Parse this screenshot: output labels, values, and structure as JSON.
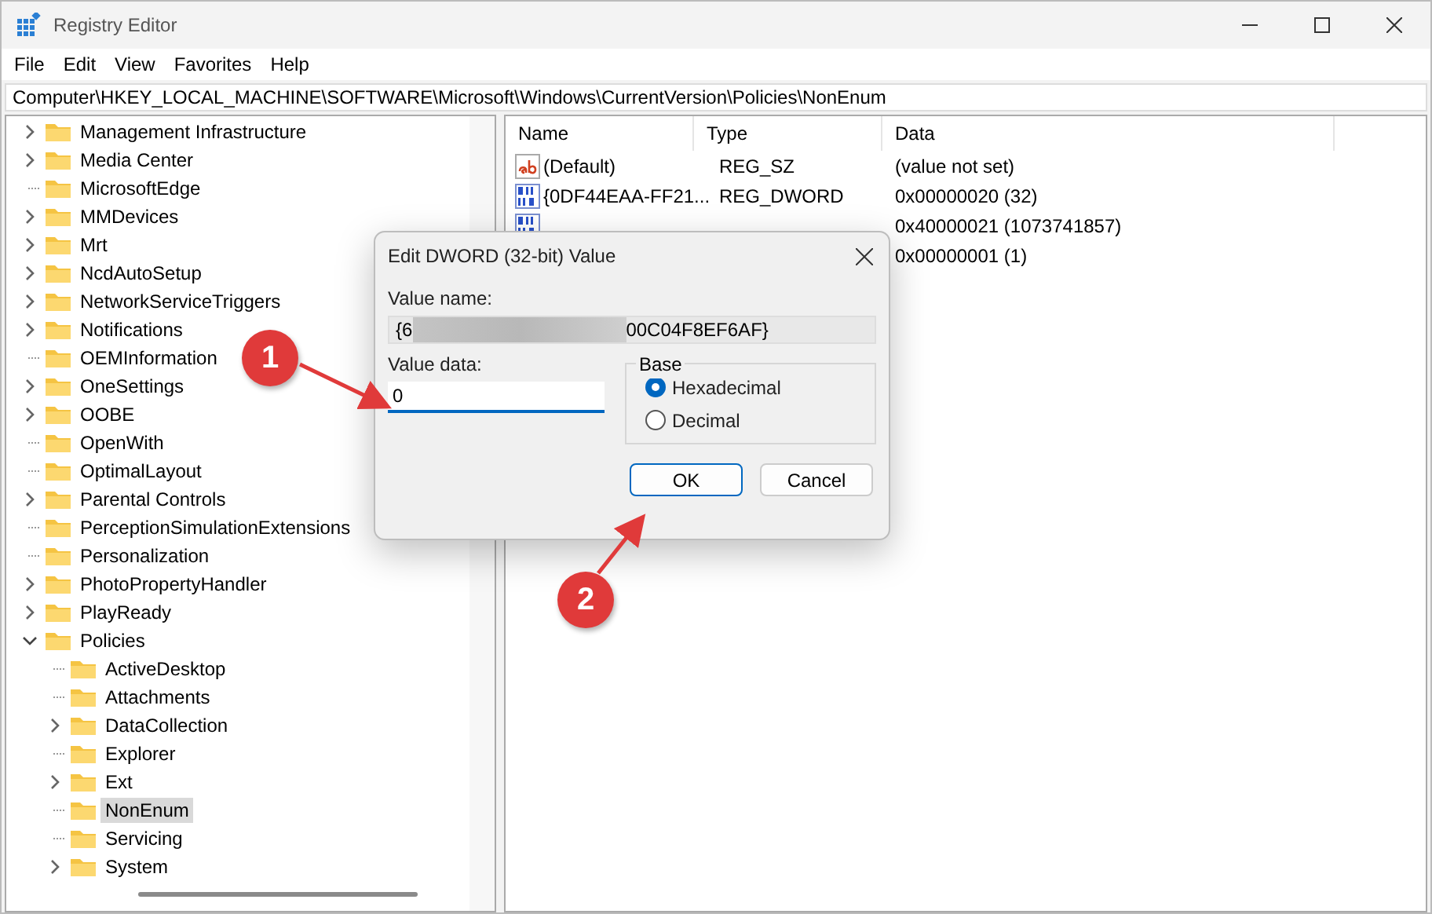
{
  "window": {
    "title": "Registry Editor"
  },
  "menu": [
    "File",
    "Edit",
    "View",
    "Favorites",
    "Help"
  ],
  "address": "Computer\\HKEY_LOCAL_MACHINE\\SOFTWARE\\Microsoft\\Windows\\CurrentVersion\\Policies\\NonEnum",
  "tree": [
    {
      "label": "Management Infrastructure",
      "kind": "collapsed",
      "selected": false
    },
    {
      "label": "Media Center",
      "kind": "collapsed",
      "selected": false
    },
    {
      "label": "MicrosoftEdge",
      "kind": "leaf",
      "selected": false
    },
    {
      "label": "MMDevices",
      "kind": "collapsed",
      "selected": false
    },
    {
      "label": "Mrt",
      "kind": "collapsed",
      "selected": false
    },
    {
      "label": "NcdAutoSetup",
      "kind": "collapsed",
      "selected": false
    },
    {
      "label": "NetworkServiceTriggers",
      "kind": "collapsed",
      "selected": false
    },
    {
      "label": "Notifications",
      "kind": "collapsed",
      "selected": false
    },
    {
      "label": "OEMInformation",
      "kind": "leaf",
      "selected": false
    },
    {
      "label": "OneSettings",
      "kind": "collapsed",
      "selected": false
    },
    {
      "label": "OOBE",
      "kind": "collapsed",
      "selected": false
    },
    {
      "label": "OpenWith",
      "kind": "leaf",
      "selected": false
    },
    {
      "label": "OptimalLayout",
      "kind": "leaf",
      "selected": false
    },
    {
      "label": "Parental Controls",
      "kind": "collapsed",
      "selected": false
    },
    {
      "label": "PerceptionSimulationExtensions",
      "kind": "leaf",
      "selected": false
    },
    {
      "label": "Personalization",
      "kind": "leaf",
      "selected": false
    },
    {
      "label": "PhotoPropertyHandler",
      "kind": "collapsed",
      "selected": false
    },
    {
      "label": "PlayReady",
      "kind": "collapsed",
      "selected": false
    },
    {
      "label": "Policies",
      "kind": "expanded",
      "selected": false,
      "children": [
        {
          "label": "ActiveDesktop",
          "kind": "leaf",
          "selected": false
        },
        {
          "label": "Attachments",
          "kind": "leaf",
          "selected": false
        },
        {
          "label": "DataCollection",
          "kind": "collapsed",
          "selected": false
        },
        {
          "label": "Explorer",
          "kind": "leaf",
          "selected": false
        },
        {
          "label": "Ext",
          "kind": "collapsed",
          "selected": false
        },
        {
          "label": "NonEnum",
          "kind": "leaf",
          "selected": true
        },
        {
          "label": "Servicing",
          "kind": "leaf",
          "selected": false
        },
        {
          "label": "System",
          "kind": "collapsed",
          "selected": false
        }
      ]
    }
  ],
  "table": {
    "columns": [
      "Name",
      "Type",
      "Data"
    ],
    "rows": [
      {
        "kind": "string",
        "name": "(Default)",
        "type": "REG_SZ",
        "data": "(value not set)"
      },
      {
        "kind": "binary",
        "name": "{0DF44EAA-FF21...",
        "type": "REG_DWORD",
        "data": "0x00000020 (32)"
      },
      {
        "kind": "binary",
        "data": "0x40000021 (1073741857)"
      },
      {
        "data": "0x00000001 (1)"
      }
    ]
  },
  "dialog": {
    "title": "Edit DWORD (32-bit) Value",
    "value_name_label": "Value name:",
    "value_name_start": "{6",
    "value_name_redacted": true,
    "value_name_end": "00C04F8EF6AF}",
    "value_data_label": "Value data:",
    "value_data": "0",
    "base_label": "Base",
    "base_options": [
      {
        "label": "Hexadecimal",
        "selected": true
      },
      {
        "label": "Decimal",
        "selected": false
      }
    ],
    "buttons": [
      {
        "label": "OK",
        "default": true
      },
      {
        "label": "Cancel",
        "default": false
      }
    ]
  },
  "annotations": [
    {
      "number": "1"
    },
    {
      "number": "2"
    }
  ]
}
